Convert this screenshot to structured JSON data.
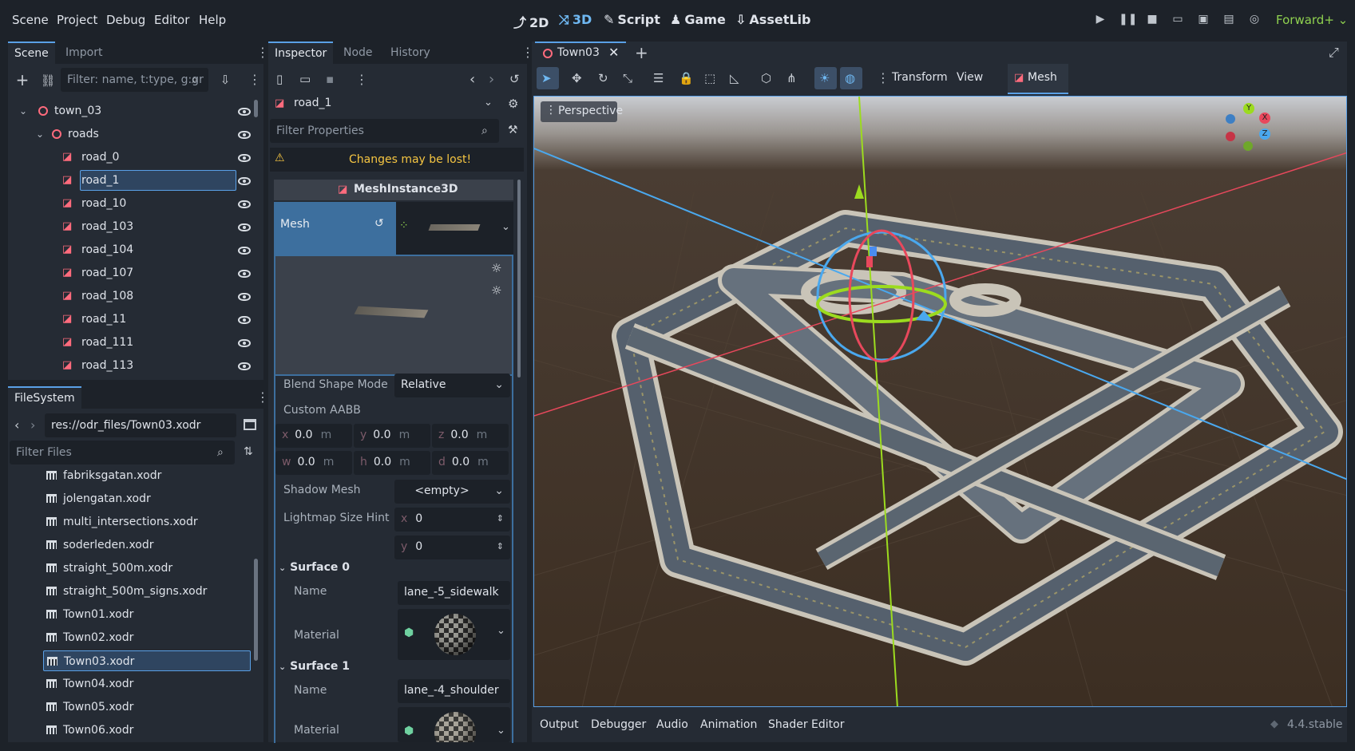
{
  "menu": [
    "Scene",
    "Project",
    "Debug",
    "Editor",
    "Help"
  ],
  "workspaces": [
    {
      "label": "2D",
      "glyph": "⤴"
    },
    {
      "label": "3D",
      "glyph": "⤨",
      "active": true
    },
    {
      "label": "Script",
      "glyph": "✎"
    },
    {
      "label": "Game",
      "glyph": "♟"
    },
    {
      "label": "AssetLib",
      "glyph": "⇩"
    }
  ],
  "renderer": "Forward+",
  "scene_dock": {
    "tabs": [
      "Scene",
      "Import"
    ],
    "filter_placeholder": "Filter: name, t:type, g:gr",
    "tree": [
      {
        "label": "town_03",
        "level": 0,
        "kind": "node3d"
      },
      {
        "label": "roads",
        "level": 1,
        "kind": "node3d"
      },
      {
        "label": "road_0",
        "level": 2,
        "kind": "mesh"
      },
      {
        "label": "road_1",
        "level": 2,
        "kind": "mesh",
        "selected": true
      },
      {
        "label": "road_10",
        "level": 2,
        "kind": "mesh"
      },
      {
        "label": "road_103",
        "level": 2,
        "kind": "mesh"
      },
      {
        "label": "road_104",
        "level": 2,
        "kind": "mesh"
      },
      {
        "label": "road_107",
        "level": 2,
        "kind": "mesh"
      },
      {
        "label": "road_108",
        "level": 2,
        "kind": "mesh"
      },
      {
        "label": "road_11",
        "level": 2,
        "kind": "mesh"
      },
      {
        "label": "road_111",
        "level": 2,
        "kind": "mesh"
      },
      {
        "label": "road_113",
        "level": 2,
        "kind": "mesh"
      }
    ]
  },
  "filesystem_dock": {
    "tab": "FileSystem",
    "path": "res://odr_files/Town03.xodr",
    "filter_placeholder": "Filter Files",
    "files": [
      {
        "label": "fabriksgatan.xodr"
      },
      {
        "label": "jolengatan.xodr"
      },
      {
        "label": "multi_intersections.xodr"
      },
      {
        "label": "soderleden.xodr"
      },
      {
        "label": "straight_500m.xodr"
      },
      {
        "label": "straight_500m_signs.xodr"
      },
      {
        "label": "Town01.xodr"
      },
      {
        "label": "Town02.xodr"
      },
      {
        "label": "Town03.xodr",
        "selected": true
      },
      {
        "label": "Town04.xodr"
      },
      {
        "label": "Town05.xodr"
      },
      {
        "label": "Town06.xodr"
      }
    ]
  },
  "inspector": {
    "tabs": [
      "Inspector",
      "Node",
      "History"
    ],
    "object_name": "road_1",
    "filter_placeholder": "Filter Properties",
    "warning": "Changes may be lost!",
    "class_name": "MeshInstance3D",
    "mesh_label": "Mesh",
    "blend_shape_mode_label": "Blend Shape Mode",
    "blend_shape_mode_value": "Relative",
    "custom_aabb_label": "Custom AABB",
    "aabb": [
      {
        "axis": "x",
        "value": "0.0",
        "unit": "m"
      },
      {
        "axis": "y",
        "value": "0.0",
        "unit": "m"
      },
      {
        "axis": "z",
        "value": "0.0",
        "unit": "m"
      },
      {
        "axis": "w",
        "value": "0.0",
        "unit": "m"
      },
      {
        "axis": "h",
        "value": "0.0",
        "unit": "m"
      },
      {
        "axis": "d",
        "value": "0.0",
        "unit": "m"
      }
    ],
    "shadow_mesh_label": "Shadow Mesh",
    "shadow_mesh_value": "<empty>",
    "lightmap_label": "Lightmap Size Hint",
    "lightmap": [
      {
        "axis": "x",
        "value": "0"
      },
      {
        "axis": "y",
        "value": "0"
      }
    ],
    "surface0": {
      "title": "Surface 0",
      "name_label": "Name",
      "name_value": "lane_-5_sidewalk",
      "material_label": "Material"
    },
    "surface1": {
      "title": "Surface 1",
      "name_label": "Name",
      "name_value": "lane_-4_shoulder",
      "material_label": "Material"
    }
  },
  "viewport": {
    "tab": "Town03",
    "toolbar_labels": [
      "Transform",
      "View"
    ],
    "mesh_menu": "Mesh",
    "perspective": "Perspective",
    "gizmo": {
      "x": "X",
      "y": "Y",
      "z": "Z"
    }
  },
  "bottom_panel": {
    "tabs": [
      "Output",
      "Debugger",
      "Audio",
      "Animation",
      "Shader Editor"
    ],
    "version": "4.4.stable"
  }
}
